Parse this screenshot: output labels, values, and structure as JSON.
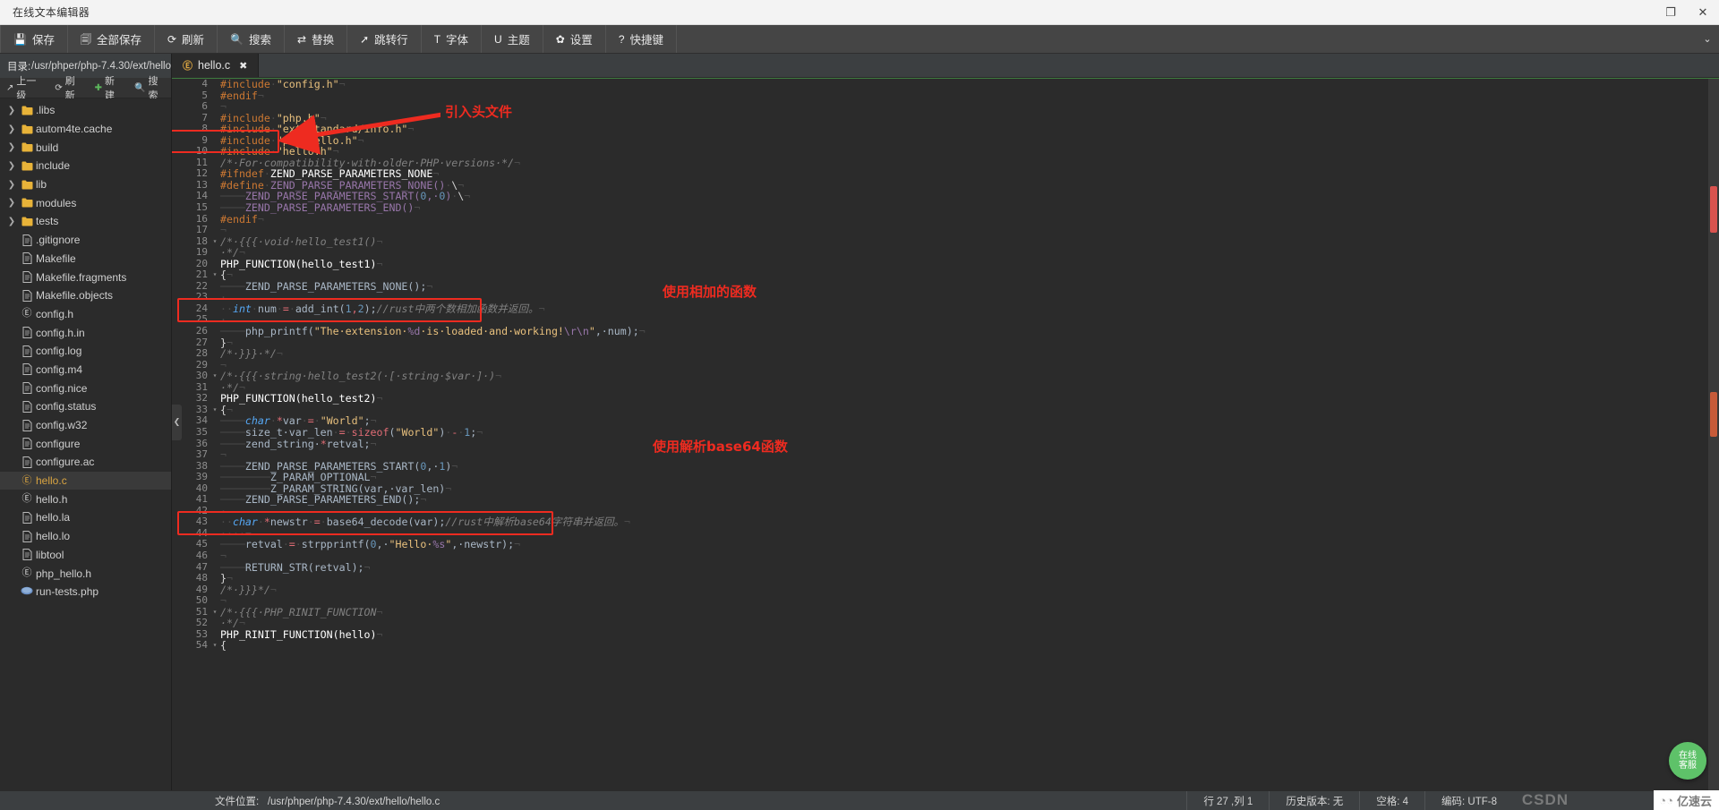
{
  "titlebar": {
    "title": "在线文本编辑器",
    "restore": "❐",
    "close": "✕"
  },
  "toolbar": {
    "items": [
      {
        "icon": "save-icon",
        "glyph": "💾",
        "label": "保存"
      },
      {
        "icon": "save-all-icon",
        "glyph": "🗐",
        "label": "全部保存"
      },
      {
        "icon": "refresh-icon",
        "glyph": "⟳",
        "label": "刷新"
      },
      {
        "icon": "search-icon",
        "glyph": "🔍",
        "label": "搜索"
      },
      {
        "icon": "replace-icon",
        "glyph": "⇄",
        "label": "替换"
      },
      {
        "icon": "goto-line-icon",
        "glyph": "➚",
        "label": "跳转行"
      },
      {
        "icon": "font-icon",
        "glyph": "T",
        "label": "字体"
      },
      {
        "icon": "theme-icon",
        "glyph": "U",
        "label": "主题"
      },
      {
        "icon": "settings-icon",
        "glyph": "✿",
        "label": "设置"
      },
      {
        "icon": "shortcut-icon",
        "glyph": "?",
        "label": "快捷键"
      }
    ],
    "collapse_glyph": "⌄"
  },
  "sidebar": {
    "dir_label": "目录:",
    "dir_path": "/usr/phper/php-7.4.30/ext/hello",
    "tools": [
      {
        "icon": "up-level-icon",
        "glyph": "↗",
        "label": "上一级"
      },
      {
        "icon": "refresh-icon",
        "glyph": "⟳",
        "label": "刷新"
      },
      {
        "icon": "new-file-icon",
        "glyph": "✚",
        "label": "新建"
      },
      {
        "icon": "search-icon",
        "glyph": "🔍",
        "label": "搜索"
      }
    ],
    "tree": [
      {
        "type": "folder",
        "name": ".libs"
      },
      {
        "type": "folder",
        "name": "autom4te.cache"
      },
      {
        "type": "folder",
        "name": "build"
      },
      {
        "type": "folder",
        "name": "include"
      },
      {
        "type": "folder",
        "name": "lib"
      },
      {
        "type": "folder",
        "name": "modules"
      },
      {
        "type": "folder",
        "name": "tests"
      },
      {
        "type": "file",
        "name": ".gitignore"
      },
      {
        "type": "file",
        "name": "Makefile"
      },
      {
        "type": "file",
        "name": "Makefile.fragments"
      },
      {
        "type": "file",
        "name": "Makefile.objects"
      },
      {
        "type": "c",
        "name": "config.h"
      },
      {
        "type": "file",
        "name": "config.h.in"
      },
      {
        "type": "file",
        "name": "config.log"
      },
      {
        "type": "file",
        "name": "config.m4"
      },
      {
        "type": "file",
        "name": "config.nice"
      },
      {
        "type": "file",
        "name": "config.status"
      },
      {
        "type": "file",
        "name": "config.w32"
      },
      {
        "type": "file",
        "name": "configure"
      },
      {
        "type": "file",
        "name": "configure.ac"
      },
      {
        "type": "c",
        "name": "hello.c",
        "selected": true
      },
      {
        "type": "c",
        "name": "hello.h"
      },
      {
        "type": "file",
        "name": "hello.la"
      },
      {
        "type": "file",
        "name": "hello.lo"
      },
      {
        "type": "file",
        "name": "libtool"
      },
      {
        "type": "c",
        "name": "php_hello.h"
      },
      {
        "type": "php",
        "name": "run-tests.php"
      }
    ]
  },
  "editor": {
    "tab": {
      "icon": "c-file-icon",
      "label": "hello.c",
      "close": "✖"
    },
    "lines": [
      {
        "n": 4,
        "fold": "",
        "html": "<span class='s-pre'>#include</span><span class='s-ws'>·</span><span class='s-str'>\"config.h\"</span><span class='s-ws'>¬</span>"
      },
      {
        "n": 5,
        "fold": "",
        "html": "<span class='s-pre'>#endif</span><span class='s-ws'>¬</span>"
      },
      {
        "n": 6,
        "fold": "",
        "html": "<span class='s-ws'>¬</span>"
      },
      {
        "n": 7,
        "fold": "",
        "html": "<span class='s-pre'>#include</span><span class='s-ws'>·</span><span class='s-str'>\"php.h\"</span><span class='s-ws'>¬</span>"
      },
      {
        "n": 8,
        "fold": "",
        "html": "<span class='s-pre'>#include</span><span class='s-ws'>·</span><span class='s-str'>\"ext/standard/info.h\"</span><span class='s-ws'>¬</span>"
      },
      {
        "n": 9,
        "fold": "",
        "html": "<span class='s-pre'>#include</span><span class='s-ws'>·</span><span class='s-str'>\"php_hello.h\"</span><span class='s-ws'>¬</span>"
      },
      {
        "n": 10,
        "fold": "",
        "html": "<span class='s-pre'>#include</span><span class='s-ws'>·</span><span class='s-str'>\"hello.h\"</span><span class='s-ws'>¬</span>"
      },
      {
        "n": 11,
        "fold": "",
        "html": "<span class='s-cmt'>/*·For·compatibility·with·older·PHP·versions·*/</span><span class='s-ws'>¬</span>"
      },
      {
        "n": 12,
        "fold": "",
        "html": "<span class='s-pre'>#ifndef</span><span class='s-ws'>·</span><span class='s-fn'>ZEND_PARSE_PARAMETERS_NONE</span><span class='s-ws'>¬</span>"
      },
      {
        "n": 13,
        "fold": "",
        "html": "<span class='s-pre'>#define</span><span class='s-ws'>·</span><span class='s-mac'>ZEND_PARSE_PARAMETERS_NONE()</span><span class='s-ws'>·</span><span class='s-plain'>\\</span><span class='s-ws'>¬</span>"
      },
      {
        "n": 14,
        "fold": "",
        "html": "<span class='s-ws'>────</span><span class='s-mac'>ZEND_PARSE_PARAMETERS_START(</span><span class='s-num'>0</span><span class='s-mac'>,·</span><span class='s-num'>0</span><span class='s-mac'>)</span><span class='s-ws'>·</span><span class='s-plain'>\\</span><span class='s-ws'>¬</span>"
      },
      {
        "n": 15,
        "fold": "",
        "html": "<span class='s-ws'>────</span><span class='s-mac'>ZEND_PARSE_PARAMETERS_END()</span><span class='s-ws'>¬</span>"
      },
      {
        "n": 16,
        "fold": "",
        "html": "<span class='s-pre'>#endif</span><span class='s-ws'>¬</span>"
      },
      {
        "n": 17,
        "fold": "",
        "html": "<span class='s-ws'>¬</span>"
      },
      {
        "n": 18,
        "fold": "▾",
        "html": "<span class='s-cmt'>/*·{{{·void·hello_test1()</span><span class='s-ws'>¬</span>"
      },
      {
        "n": 19,
        "fold": "",
        "html": "<span class='s-cmt'>·*/</span><span class='s-ws'>¬</span>"
      },
      {
        "n": 20,
        "fold": "",
        "html": "<span class='s-fn'>PHP_FUNCTION(hello_test1)</span><span class='s-ws'>¬</span>"
      },
      {
        "n": 21,
        "fold": "▾",
        "html": "<span class='s-plain'>{</span><span class='s-ws'>¬</span>"
      },
      {
        "n": 22,
        "fold": "",
        "html": "<span class='s-ws'>────</span><span class='s-def'>ZEND_PARSE_PARAMETERS_NONE();</span><span class='s-ws'>¬</span>"
      },
      {
        "n": 23,
        "fold": "",
        "html": "<span class='s-ws'>·</span>"
      },
      {
        "n": 24,
        "fold": "",
        "html": "<span class='s-ws'>··</span><span class='s-kw'>int</span><span class='s-ws'>·</span><span class='s-def'>num</span><span class='s-ws'>·</span><span class='s-op'>=</span><span class='s-ws'>·</span><span class='s-def'>add_int(</span><span class='s-num'>1</span><span class='s-op'>,</span><span class='s-num'>2</span><span class='s-def'>);</span><span class='s-cmt'>//rust中两个数相加函数并返回。</span><span class='s-ws'>¬</span>"
      },
      {
        "n": 25,
        "fold": "",
        "html": "<span class='s-ws'>·</span>"
      },
      {
        "n": 26,
        "fold": "",
        "html": "<span class='s-ws'>────</span><span class='s-def'>php_printf(</span><span class='s-str'>\"The·extension·</span><span class='s-fmt'>%d</span><span class='s-str'>·is·loaded·and·working!</span><span class='s-fmt'>\\r\\n</span><span class='s-str'>\"</span><span class='s-def'>,·num);</span><span class='s-ws'>¬</span>"
      },
      {
        "n": 27,
        "fold": "",
        "html": "<span class='s-plain'>}</span><span class='s-ws'>¬</span>"
      },
      {
        "n": 28,
        "fold": "",
        "html": "<span class='s-cmt'>/*·}}}·*/</span><span class='s-ws'>¬</span>"
      },
      {
        "n": 29,
        "fold": "",
        "html": "<span class='s-ws'>¬</span>"
      },
      {
        "n": 30,
        "fold": "▾",
        "html": "<span class='s-cmt'>/*·{{{·string·hello_test2(·[·string·$var·]·)</span><span class='s-ws'>¬</span>"
      },
      {
        "n": 31,
        "fold": "",
        "html": "<span class='s-cmt'>·*/</span><span class='s-ws'>¬</span>"
      },
      {
        "n": 32,
        "fold": "",
        "html": "<span class='s-fn'>PHP_FUNCTION(hello_test2)</span><span class='s-ws'>¬</span>"
      },
      {
        "n": 33,
        "fold": "▾",
        "html": "<span class='s-plain'>{</span><span class='s-ws'>¬</span>"
      },
      {
        "n": 34,
        "fold": "",
        "html": "<span class='s-ws'>────</span><span class='s-kw'>char</span><span class='s-ws'>·</span><span class='s-op'>*</span><span class='s-def'>var</span><span class='s-ws'>·</span><span class='s-op'>=</span><span class='s-ws'>·</span><span class='s-str'>\"World\"</span><span class='s-def'>;</span><span class='s-ws'>¬</span>"
      },
      {
        "n": 35,
        "fold": "",
        "html": "<span class='s-ws'>────</span><span class='s-def'>size_t·var_len</span><span class='s-ws'>·</span><span class='s-op'>=</span><span class='s-ws'>·</span><span class='s-op'>sizeof</span><span class='s-def'>(</span><span class='s-str'>\"World\"</span><span class='s-def'>)</span><span class='s-ws'>·</span><span class='s-op'>-</span><span class='s-ws'>·</span><span class='s-num'>1</span><span class='s-def'>;</span><span class='s-ws'>¬</span>"
      },
      {
        "n": 36,
        "fold": "",
        "html": "<span class='s-ws'>────</span><span class='s-def'>zend_string·</span><span class='s-op'>*</span><span class='s-def'>retval;</span><span class='s-ws'>¬</span>"
      },
      {
        "n": 37,
        "fold": "",
        "html": "<span class='s-ws'>¬</span>"
      },
      {
        "n": 38,
        "fold": "",
        "html": "<span class='s-ws'>────</span><span class='s-def'>ZEND_PARSE_PARAMETERS_START(</span><span class='s-num'>0</span><span class='s-def'>,·</span><span class='s-num'>1</span><span class='s-def'>)</span><span class='s-ws'>¬</span>"
      },
      {
        "n": 39,
        "fold": "",
        "html": "<span class='s-ws'>────────</span><span class='s-def'>Z_PARAM_OPTIONAL</span><span class='s-ws'>¬</span>"
      },
      {
        "n": 40,
        "fold": "",
        "html": "<span class='s-ws'>────────</span><span class='s-def'>Z_PARAM_STRING(var,·var_len)</span><span class='s-ws'>¬</span>"
      },
      {
        "n": 41,
        "fold": "",
        "html": "<span class='s-ws'>────</span><span class='s-def'>ZEND_PARSE_PARAMETERS_END();</span><span class='s-ws'>¬</span>"
      },
      {
        "n": 42,
        "fold": "",
        "html": "<span class='s-ws'>·</span>"
      },
      {
        "n": 43,
        "fold": "",
        "html": "<span class='s-ws'>··</span><span class='s-kw'>char</span><span class='s-ws'>·</span><span class='s-op'>*</span><span class='s-def'>newstr</span><span class='s-ws'>·</span><span class='s-op'>=</span><span class='s-ws'>·</span><span class='s-def'>base64_decode(var);</span><span class='s-cmt'>//rust中解析base64字符串并返回。</span><span class='s-ws'>¬</span>"
      },
      {
        "n": 44,
        "fold": "",
        "html": "<span class='s-ws'>····¬</span>"
      },
      {
        "n": 45,
        "fold": "",
        "html": "<span class='s-ws'>────</span><span class='s-def'>retval</span><span class='s-ws'>·</span><span class='s-op'>=</span><span class='s-ws'>·</span><span class='s-def'>strpprintf(</span><span class='s-num'>0</span><span class='s-def'>,·</span><span class='s-str'>\"Hello·</span><span class='s-fmt'>%s</span><span class='s-str'>\"</span><span class='s-def'>,·newstr);</span><span class='s-ws'>¬</span>"
      },
      {
        "n": 46,
        "fold": "",
        "html": "<span class='s-ws'>¬</span>"
      },
      {
        "n": 47,
        "fold": "",
        "html": "<span class='s-ws'>────</span><span class='s-def'>RETURN_STR(retval);</span><span class='s-ws'>¬</span>"
      },
      {
        "n": 48,
        "fold": "",
        "html": "<span class='s-plain'>}</span><span class='s-ws'>¬</span>"
      },
      {
        "n": 49,
        "fold": "",
        "html": "<span class='s-cmt'>/*·}}}*/</span><span class='s-ws'>¬</span>"
      },
      {
        "n": 50,
        "fold": "",
        "html": "<span class='s-ws'>¬</span>"
      },
      {
        "n": 51,
        "fold": "▾",
        "html": "<span class='s-cmt'>/*·{{{·PHP_RINIT_FUNCTION</span><span class='s-ws'>¬</span>"
      },
      {
        "n": 52,
        "fold": "",
        "html": "<span class='s-cmt'>·*/</span><span class='s-ws'>¬</span>"
      },
      {
        "n": 53,
        "fold": "",
        "html": "<span class='s-fn'>PHP_RINIT_FUNCTION(hello)</span><span class='s-ws'>¬</span>"
      },
      {
        "n": 54,
        "fold": "▾",
        "html": "<span class='s-plain'>{</span>"
      }
    ],
    "annotations": [
      {
        "text": "引入头文件"
      },
      {
        "text": "使用相加的函数"
      },
      {
        "text": "使用解析base64函数"
      }
    ],
    "online_badge": {
      "line1": "在线",
      "line2": "客服"
    }
  },
  "statusbar": {
    "file_label": "文件位置:",
    "file_path": "/usr/phper/php-7.4.30/ext/hello/hello.c",
    "cells": [
      "行 27 ,列 1",
      "历史版本: 无",
      "空格: 4",
      "编码: UTF-8"
    ],
    "watermark": "CSDN",
    "vendor": "亿速云"
  },
  "colors": {
    "accent_red": "#ee2b20",
    "selected_file": "#d9a441",
    "toolbar_bg": "#454545",
    "editor_bg": "#2b2b2b"
  }
}
